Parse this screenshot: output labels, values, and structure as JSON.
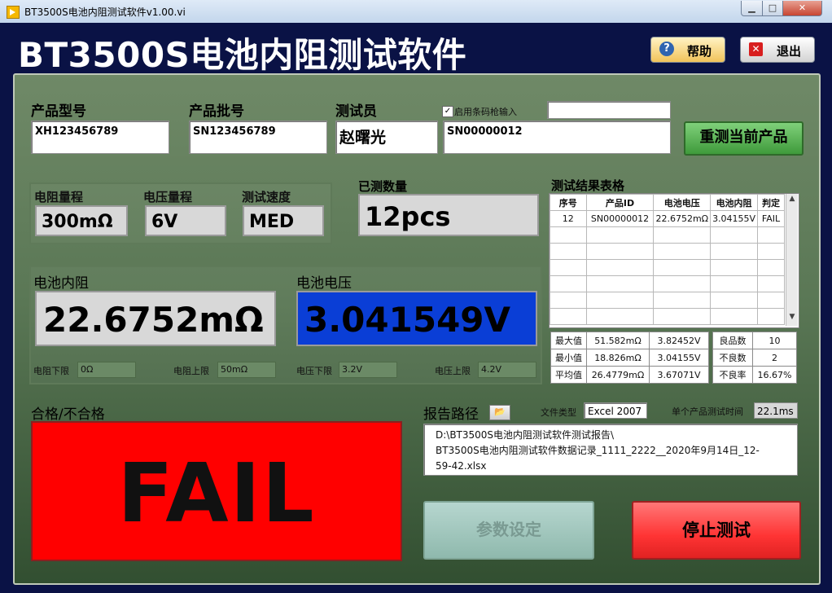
{
  "window": {
    "title": "BT3500S电池内阻测试软件v1.00.vi",
    "min": "▁",
    "max": "□",
    "close": "✕"
  },
  "app": {
    "title": "BT3500S电池内阻测试软件",
    "help_label": "帮助",
    "exit_label": "退出"
  },
  "product": {
    "model_label": "产品型号",
    "model_value": "XH123456789",
    "batch_label": "产品批号",
    "batch_value": "SN123456789",
    "tester_label": "测试员",
    "tester_value": "赵曙光",
    "barcode_label": "启用条码枪输入",
    "barcode_checked": true,
    "barcode_extra": "",
    "serial_value": "SN00000012",
    "retest_label": "重测当前产品"
  },
  "range": {
    "res_label": "电阻量程",
    "res_value": "300mΩ",
    "volt_label": "电压量程",
    "volt_value": "6V",
    "speed_label": "测试速度",
    "speed_value": "MED"
  },
  "count": {
    "label": "已测数量",
    "value": "12pcs"
  },
  "measure": {
    "res_label": "电池内阻",
    "res_value": "22.6752mΩ",
    "volt_label": "电池电压",
    "volt_value": "3.041549V",
    "res_low_label": "电阻下限",
    "res_low_value": "0Ω",
    "res_high_label": "电阻上限",
    "res_high_value": "50mΩ",
    "volt_low_label": "电压下限",
    "volt_low_value": "3.2V",
    "volt_high_label": "电压上限",
    "volt_high_value": "4.2V"
  },
  "results": {
    "title": "测试结果表格",
    "headers": [
      "序号",
      "产品ID",
      "电池电压",
      "电池内阻",
      "判定"
    ],
    "row": [
      "12",
      "SN00000012",
      "22.6752mΩ",
      "3.04155V",
      "FAIL"
    ]
  },
  "stats": {
    "max_label": "最大值",
    "max_res": "51.582mΩ",
    "max_volt": "3.82452V",
    "min_label": "最小值",
    "min_res": "18.826mΩ",
    "min_volt": "3.04155V",
    "avg_label": "平均值",
    "avg_res": "26.4779mΩ",
    "avg_volt": "3.67071V",
    "good_label": "良品数",
    "good_value": "10",
    "bad_label": "不良数",
    "bad_value": "2",
    "bad_rate_label": "不良率",
    "bad_rate_value": "16.67%"
  },
  "verdict": {
    "label": "合格/不合格",
    "value": "FAIL",
    "color": "#ff0000"
  },
  "report": {
    "path_label": "报告路径",
    "filetype_label": "文件类型",
    "filetype_value": "Excel 2007",
    "time_label": "单个产品测试时间",
    "time_value": "22.1ms",
    "path_line1": "D:\\BT3500S电池内阻测试软件测试报告\\",
    "path_line2": "BT3500S电池内阻测试软件数据记录_1111_2222__2020年9月14日_12-",
    "path_line3": "59-42.xlsx"
  },
  "buttons": {
    "param_label": "参数设定",
    "stop_label": "停止测试"
  },
  "colors": {
    "voltage_bg": "#0a3ed6",
    "fail_bg": "#ff0000",
    "app_bg": "#0a1245"
  }
}
